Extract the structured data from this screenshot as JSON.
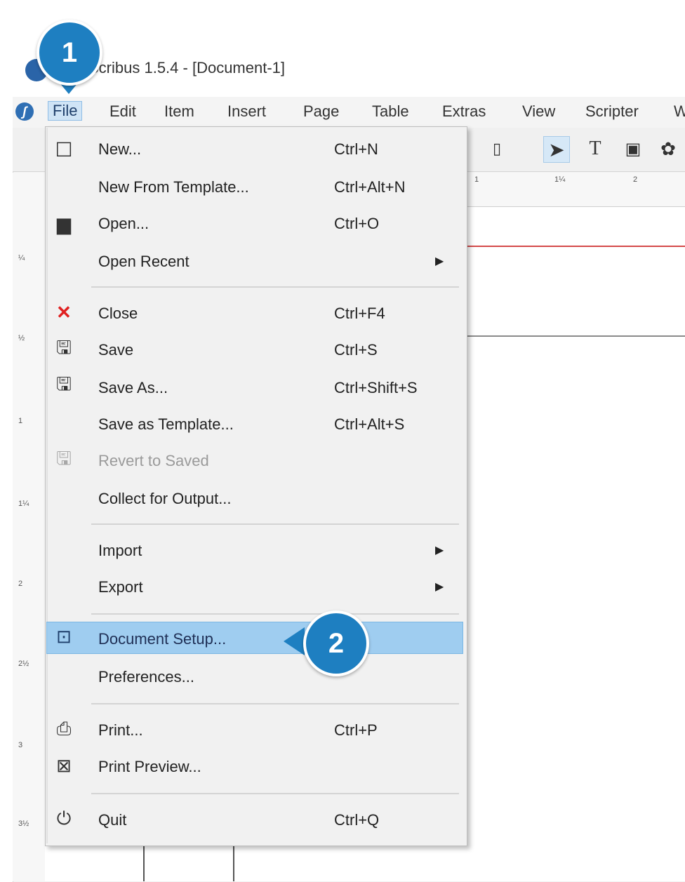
{
  "window": {
    "title": "Scribus 1.5.4 - [Document-1]"
  },
  "menubar": {
    "items": [
      "File",
      "Edit",
      "Item",
      "Insert",
      "Page",
      "Table",
      "Extras",
      "View",
      "Scripter",
      "W"
    ]
  },
  "toolbar": {
    "icons": [
      "page-icon",
      "select-arrow-icon",
      "text-frame-icon",
      "image-frame-icon",
      "shape-icon"
    ]
  },
  "ruler": {
    "top_labels": [
      "1",
      "1¼",
      "2"
    ],
    "left_labels": [
      "¼",
      "½",
      "1",
      "1¼",
      "2",
      "2½",
      "3",
      "3½"
    ]
  },
  "file_menu": {
    "items": [
      {
        "label": "New...",
        "shortcut": "Ctrl+N",
        "icon": "new-page-icon"
      },
      {
        "label": "New From Template...",
        "shortcut": "Ctrl+Alt+N",
        "icon": ""
      },
      {
        "label": "Open...",
        "shortcut": "Ctrl+O",
        "icon": "folder-icon"
      },
      {
        "label": "Open Recent",
        "shortcut": "",
        "icon": "",
        "submenu": true
      },
      {
        "label": "Close",
        "shortcut": "Ctrl+F4",
        "icon": "close-icon"
      },
      {
        "label": "Save",
        "shortcut": "Ctrl+S",
        "icon": "save-icon"
      },
      {
        "label": "Save As...",
        "shortcut": "Ctrl+Shift+S",
        "icon": "save-as-icon"
      },
      {
        "label": "Save as Template...",
        "shortcut": "Ctrl+Alt+S",
        "icon": ""
      },
      {
        "label": "Revert to Saved",
        "shortcut": "",
        "icon": "revert-icon",
        "disabled": true
      },
      {
        "label": "Collect for Output...",
        "shortcut": "",
        "icon": ""
      },
      {
        "label": "Import",
        "shortcut": "",
        "icon": "",
        "submenu": true
      },
      {
        "label": "Export",
        "shortcut": "",
        "icon": "",
        "submenu": true
      },
      {
        "label": "Document Setup...",
        "shortcut": "",
        "icon": "document-setup-icon",
        "highlighted": true
      },
      {
        "label": "Preferences...",
        "shortcut": "",
        "icon": ""
      },
      {
        "label": "Print...",
        "shortcut": "Ctrl+P",
        "icon": "printer-icon"
      },
      {
        "label": "Print Preview...",
        "shortcut": "",
        "icon": "print-preview-icon"
      },
      {
        "label": "Quit",
        "shortcut": "Ctrl+Q",
        "icon": "power-icon"
      }
    ]
  },
  "callouts": {
    "step1": "1",
    "step2": "2"
  },
  "colors": {
    "highlight": "#9fcdf0",
    "callout": "#1e7fc1",
    "close_icon": "#e02020",
    "guide_red": "#d44a4a"
  }
}
